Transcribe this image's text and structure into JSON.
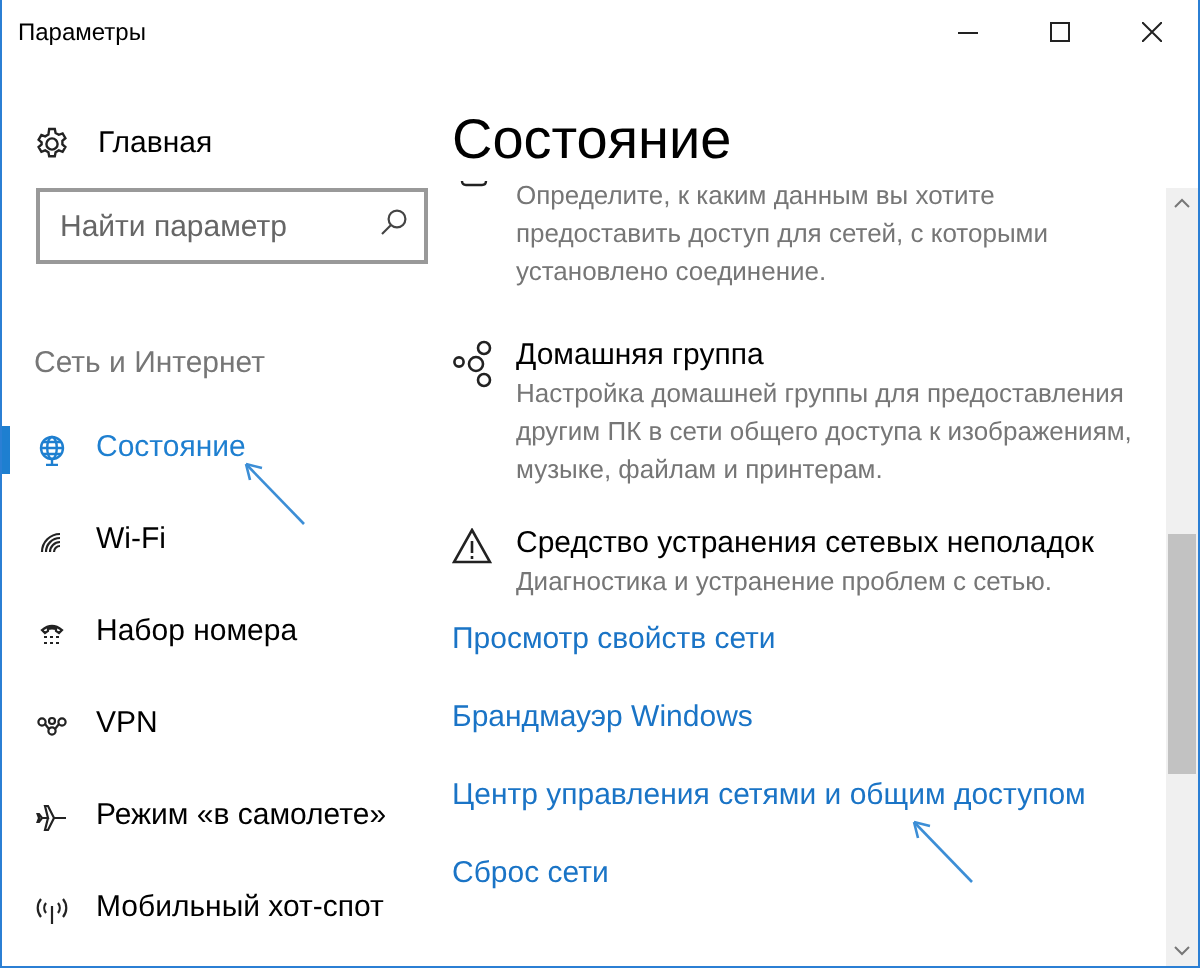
{
  "window": {
    "title": "Параметры"
  },
  "sidebar": {
    "home": {
      "label": "Главная"
    },
    "search": {
      "placeholder": "Найти параметр"
    },
    "section_label": "Сеть и Интернет",
    "items": [
      {
        "kind": "status",
        "label": "Состояние",
        "selected": true
      },
      {
        "kind": "wifi",
        "label": "Wi-Fi",
        "selected": false
      },
      {
        "kind": "dialup",
        "label": "Набор номера",
        "selected": false
      },
      {
        "kind": "vpn",
        "label": "VPN",
        "selected": false
      },
      {
        "kind": "airplane",
        "label": "Режим «в самолете»",
        "selected": false
      },
      {
        "kind": "hotspot",
        "label": "Мобильный хот-спот",
        "selected": false
      }
    ]
  },
  "content": {
    "title": "Состояние",
    "items": [
      {
        "kind": "cut",
        "description": "Определите, к каким данным вы хотите предоставить доступ для сетей, с которыми установлено соединение."
      },
      {
        "kind": "homegroup",
        "title": "Домашняя группа",
        "description": "Настройка домашней группы для предоставления другим ПК в сети общего доступа к изображениям, музыке, файлам и принтерам."
      },
      {
        "kind": "warning",
        "title": "Средство устранения сетевых неполадок",
        "description": "Диагностика и устранение проблем с сетью."
      }
    ],
    "links": [
      "Просмотр свойств сети",
      "Брандмауэр Windows",
      "Центр управления сетями и общим доступом",
      "Сброс сети"
    ]
  }
}
